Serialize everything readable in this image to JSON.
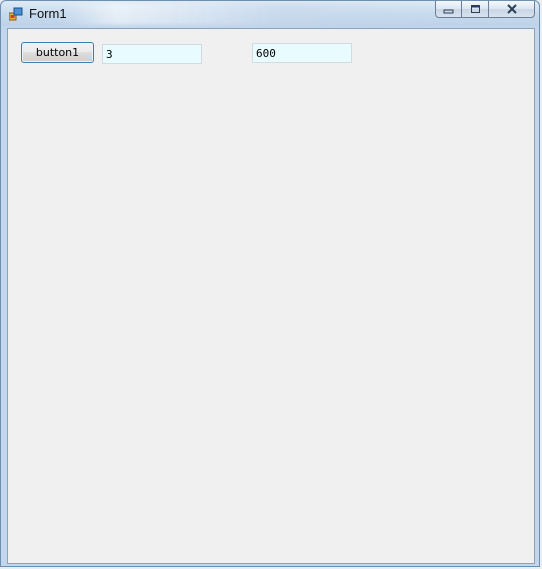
{
  "window": {
    "title": "Form1"
  },
  "caption_buttons": {
    "minimize_icon": "minimize-icon",
    "maximize_icon": "maximize-icon",
    "close_icon": "close-icon"
  },
  "form": {
    "button_label": "button1",
    "textbox1_value": "3",
    "textbox2_value": "600"
  },
  "colors": {
    "textbox_background": "#e8fcff",
    "button_border": "#3c7fb1",
    "client_background": "#f0f0f0"
  }
}
